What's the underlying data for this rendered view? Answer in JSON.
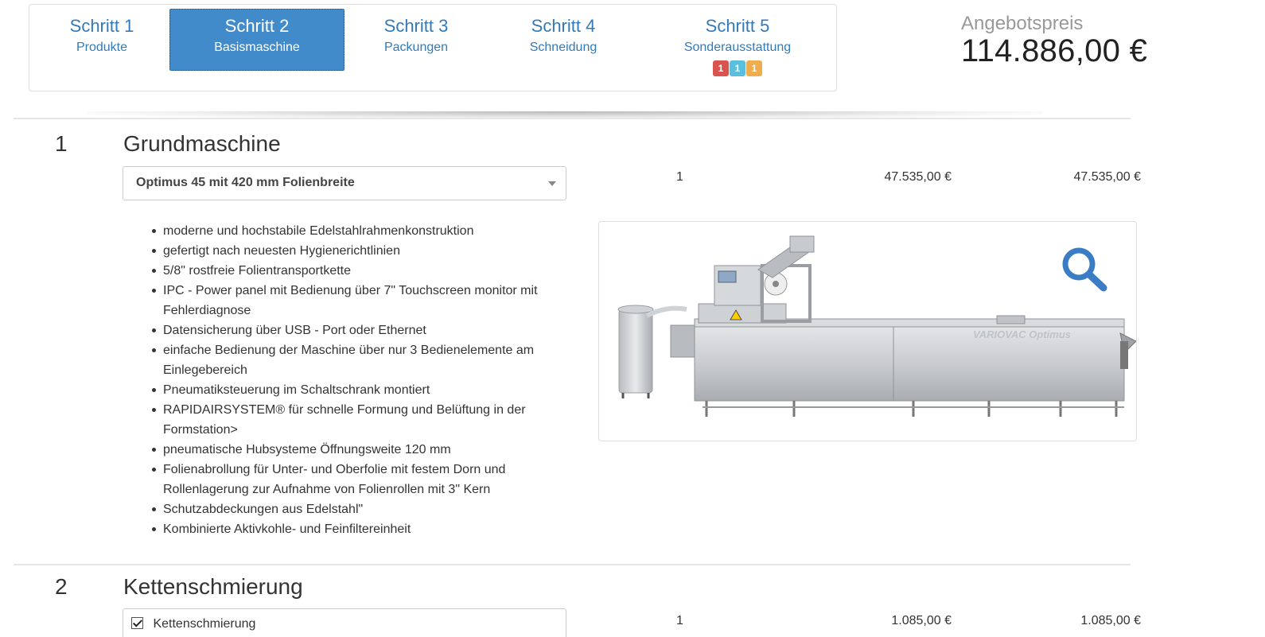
{
  "steps": [
    {
      "label": "Schritt 1",
      "sub": "Produkte",
      "active": false
    },
    {
      "label": "Schritt 2",
      "sub": "Basismaschine",
      "active": true
    },
    {
      "label": "Schritt 3",
      "sub": "Packungen",
      "active": false
    },
    {
      "label": "Schritt 4",
      "sub": "Schneidung",
      "active": false
    },
    {
      "label": "Schritt 5",
      "sub": "Sonderausstattung",
      "active": false
    }
  ],
  "badges": [
    {
      "value": "1",
      "color": "#d9534f"
    },
    {
      "value": "1",
      "color": "#5bc0de"
    },
    {
      "value": "1",
      "color": "#f0ad4e"
    }
  ],
  "price": {
    "label": "Angebotspreis",
    "value": "114.886,00 €"
  },
  "sections": [
    {
      "number": "1",
      "title": "Grundmaschine",
      "select_value": "Optimus 45 mit 420 mm Folienbreite",
      "qty": "1",
      "unit_price": "47.535,00 €",
      "total": "47.535,00 €",
      "features": [
        "moderne und hochstabile Edelstahlrahmenkonstruktion",
        "gefertigt nach neuesten Hygienerichtlinien",
        "5/8\" rostfreie Folientransportkette",
        "IPC - Power panel mit Bedienung über 7\" Touchscreen monitor mit Fehlerdiagnose",
        "Datensicherung über USB - Port oder Ethernet",
        "einfache Bedienung der Maschine über nur 3 Bedienelemente am Einlegebereich",
        "Pneumatiksteuerung im Schaltschrank montiert",
        "RAPIDAIRSYSTEM® für schnelle Formung und Belüftung in der Formstation>",
        "pneumatische Hubsysteme Öffnungsweite 120 mm",
        "Folienabrollung für Unter- und Oberfolie mit festem Dorn und Rollenlagerung zur Aufnahme von Folienrollen mit 3\" Kern",
        "Schutzabdeckungen aus Edelstahl\"",
        "Kombinierte Aktivkohle- und Feinfiltereinheit"
      ],
      "image_brand": "VARIOVAC Optimus"
    },
    {
      "number": "2",
      "title": "Kettenschmierung",
      "checkbox_label": "Kettenschmierung",
      "checked": true,
      "qty": "1",
      "unit_price": "1.085,00 €",
      "total": "1.085,00 €"
    }
  ],
  "colors": {
    "accent": "#428bca",
    "link": "#337ab7"
  }
}
